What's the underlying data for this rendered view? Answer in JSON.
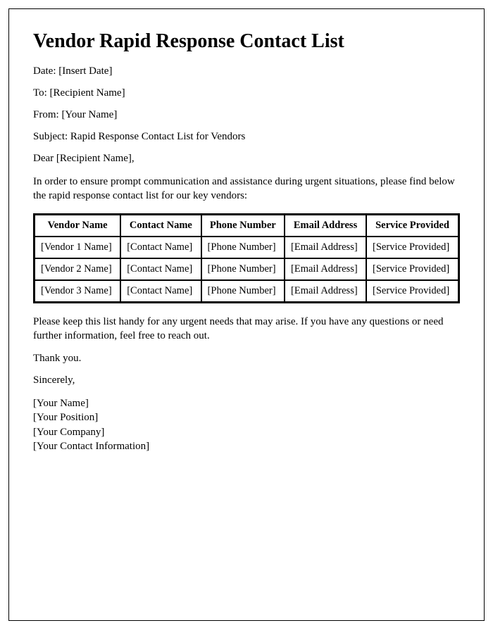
{
  "title": "Vendor Rapid Response Contact List",
  "fields": {
    "date_label": "Date: ",
    "date_value": "[Insert Date]",
    "to_label": "To: ",
    "to_value": "[Recipient Name]",
    "from_label": "From: ",
    "from_value": "[Your Name]",
    "subject_label": "Subject: ",
    "subject_value": "Rapid Response Contact List for Vendors"
  },
  "salutation": "Dear [Recipient Name],",
  "intro": "In order to ensure prompt communication and assistance during urgent situations, please find below the rapid response contact list for our key vendors:",
  "table": {
    "headers": {
      "vendor": "Vendor Name",
      "contact": "Contact Name",
      "phone": "Phone Number",
      "email": "Email Address",
      "service": "Service Provided"
    },
    "rows": [
      {
        "vendor": "[Vendor 1 Name]",
        "contact": "[Contact Name]",
        "phone": "[Phone Number]",
        "email": "[Email Address]",
        "service": "[Service Provided]"
      },
      {
        "vendor": "[Vendor 2 Name]",
        "contact": "[Contact Name]",
        "phone": "[Phone Number]",
        "email": "[Email Address]",
        "service": "[Service Provided]"
      },
      {
        "vendor": "[Vendor 3 Name]",
        "contact": "[Contact Name]",
        "phone": "[Phone Number]",
        "email": "[Email Address]",
        "service": "[Service Provided]"
      }
    ]
  },
  "closing1": "Please keep this list handy for any urgent needs that may arise. If you have any questions or need further information, feel free to reach out.",
  "thanks": "Thank you.",
  "signoff": "Sincerely,",
  "signature": {
    "name": "[Your Name]",
    "position": "[Your Position]",
    "company": "[Your Company]",
    "contact": "[Your Contact Information]"
  }
}
